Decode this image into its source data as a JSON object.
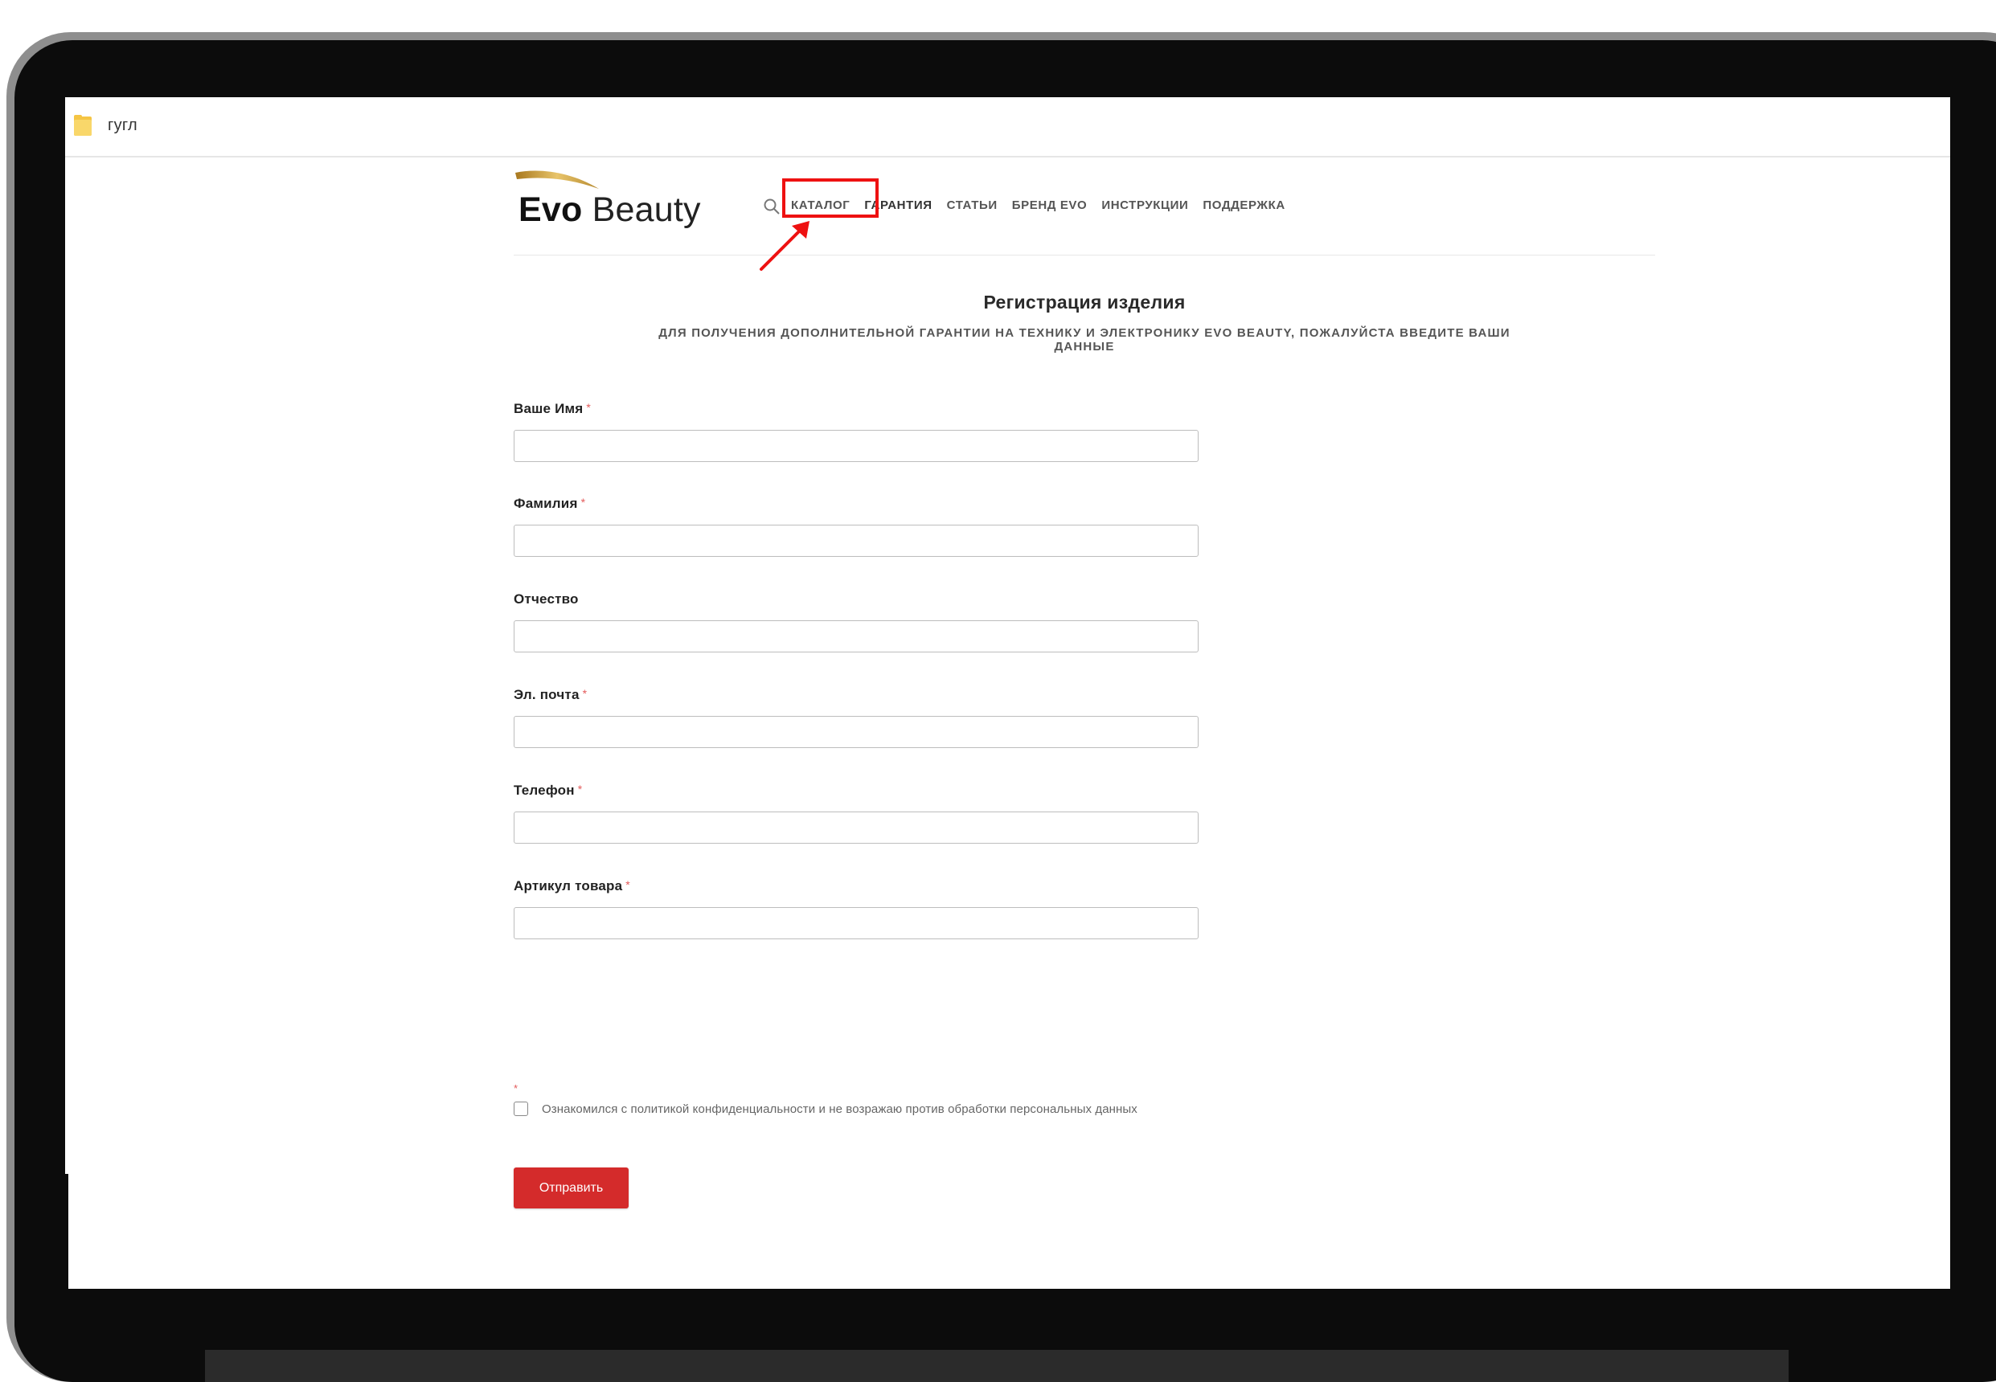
{
  "bookmarks": [
    {
      "label": "гугл",
      "icon": "folder-icon"
    }
  ],
  "logo": {
    "bold": "Evo",
    "light": "Beauty"
  },
  "nav": {
    "items": [
      "КАТАЛОГ",
      "ГАРАНТИЯ",
      "СТАТЬИ",
      "БРЕНД EVO",
      "ИНСТРУКЦИИ",
      "ПОДДЕРЖКА"
    ],
    "highlighted": "КАТАЛОГ"
  },
  "page": {
    "title": "Регистрация изделия",
    "subtitle_line1": "ДЛЯ ПОЛУЧЕНИЯ ДОПОЛНИТЕЛЬНОЙ ГАРАНТИИ НА ТЕХНИКУ И ЭЛЕКТРОНИКУ EVO BEAUTY, ПОЖАЛУЙСТА ВВЕДИТЕ ВАШИ",
    "subtitle_line2": "ДАННЫЕ"
  },
  "form": {
    "fields": [
      {
        "label": "Ваше Имя",
        "required": "*",
        "value": ""
      },
      {
        "label": "Фамилия",
        "required": "*",
        "value": ""
      },
      {
        "label": "Отчество",
        "required": "",
        "value": ""
      },
      {
        "label": "Эл. почта",
        "required": "*",
        "value": ""
      },
      {
        "label": "Телефон",
        "required": "*",
        "value": ""
      },
      {
        "label": "Артикул товара",
        "required": "*",
        "value": ""
      }
    ],
    "consent_required": "*",
    "consent_text": "Ознакомился с политикой конфиденциальности и не возражаю против обработки персональных данных",
    "consent_checked": false,
    "submit_label": "Отправить"
  },
  "colors": {
    "accent": "#d42b2b",
    "annotation": "#ee1111",
    "logo_gold": "#c8a24a"
  }
}
